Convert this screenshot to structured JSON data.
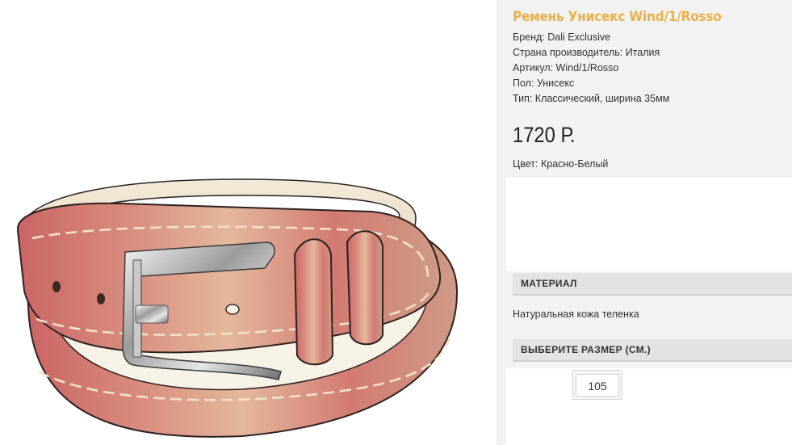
{
  "product": {
    "title": "Ремень Унисекс Wind/1/Rosso",
    "specs": [
      "Бренд: Dali Exclusive",
      "Страна производитель: Италия",
      "Артикул: Wind/1/Rosso",
      "Пол: Унисекс",
      "Тип: Классический, ширина 35мм"
    ],
    "price": "1720 Р.",
    "color": "Цвет: Красно-Белый",
    "image_alt": "belt-photo"
  },
  "material_section": {
    "header": "Материал",
    "text": "Натуральная кожа теленка"
  },
  "size_section": {
    "header": "Выберите размер (см.)",
    "options": [
      "105"
    ]
  },
  "colors": {
    "title_accent": "#e8b24a",
    "panel_bg": "#f2f2f2",
    "header_bg": "#e3e3e3"
  }
}
